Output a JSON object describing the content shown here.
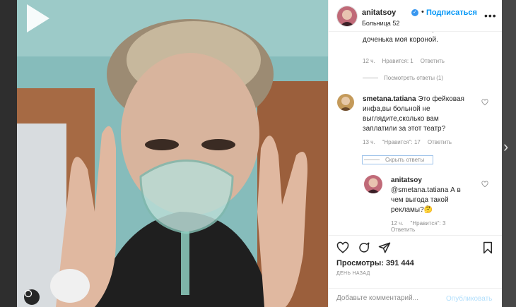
{
  "header": {
    "username": "anitatsoy",
    "verified_mark": "✓",
    "separator": "•",
    "follow_label": "Подписаться",
    "location": "Больница 52",
    "more_label": "•••"
  },
  "comments": [
    {
      "partial_text": "тяжелой пневмонией, я доченька моя короной.",
      "time": "12 ч.",
      "likes": "Нравится: 1",
      "reply_label": "Ответить",
      "thread_toggle": "Посмотреть ответы (1)"
    },
    {
      "username": "smetana.tatiana",
      "text": "Это фейковая инфа,вы больной не выглядите,сколько вам заплатили за этот театр?",
      "time": "13 ч.",
      "likes": "\"Нравится\": 17",
      "reply_label": "Ответить",
      "thread_toggle": "Скрыть ответы"
    },
    {
      "username": "anitatsoy",
      "text": "@smetana.tatiana А в чем выгода такой рекламы?🤔",
      "time": "12 ч.",
      "likes": "\"Нравится\": 3",
      "reply_label": "Ответить"
    }
  ],
  "actions": {
    "icons": [
      "heart-icon",
      "comment-icon",
      "share-icon",
      "bookmark-icon"
    ],
    "views": "Просмотры: 391 444",
    "posted": "ДЕНЬ НАЗАД"
  },
  "add_comment": {
    "placeholder": "Добавьте комментарий...",
    "publish_label": "Опубликовать"
  },
  "colors": {
    "accent": "#0095f6",
    "publish_disabled": "#b2dffc",
    "muted": "#8e8e8e",
    "text": "#262626"
  }
}
